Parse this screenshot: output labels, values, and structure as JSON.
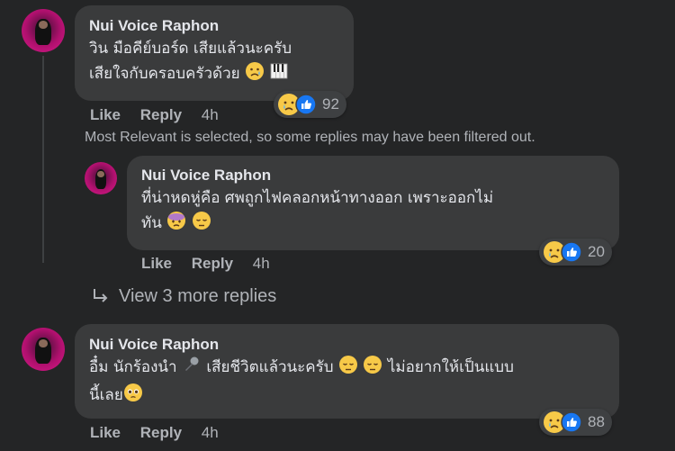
{
  "comments": [
    {
      "author": "Nui Voice Raphon",
      "line1": "วิน มือคีย์บอร์ด เสียแล้วนะครับ",
      "line2": "เสียใจกับครอบครัวด้วย",
      "reaction_count": "92",
      "like_label": "Like",
      "reply_label": "Reply",
      "time": "4h"
    },
    {
      "author": "Nui Voice Raphon",
      "line1": "ที่น่าหดหู่คือ ศพถูกไฟคลอกหน้าทางออก เพราะออกไม่",
      "line2": "ทัน",
      "reaction_count": "20",
      "like_label": "Like",
      "reply_label": "Reply",
      "time": "4h"
    },
    {
      "author": "Nui Voice Raphon",
      "line1a": "อื๋ม นักร้องนำ",
      "line1b": "เสียชีวิตแล้วนะครับ",
      "line1c": "ไม่อยากให้เป็นแบบ",
      "line2": "นี้เลย",
      "reaction_count": "88",
      "like_label": "Like",
      "reply_label": "Reply",
      "time": "4h"
    }
  ],
  "filter_notice": "Most Relevant is selected, so some replies may have been filtered out.",
  "view_more": "View 3 more replies",
  "icons": {
    "reaction_sad": "crying-face",
    "reaction_like": "thumbs-up",
    "piano": "piano-keys",
    "microphone": "microphone",
    "pensive": "pensive-face",
    "dizzy": "dizzy-face",
    "pleading": "pleading-face"
  },
  "colors": {
    "background": "#242526",
    "bubble": "#3a3b3c",
    "text_primary": "#e4e6eb",
    "text_secondary": "#b0b3b8",
    "like_blue": "#1877f2"
  }
}
